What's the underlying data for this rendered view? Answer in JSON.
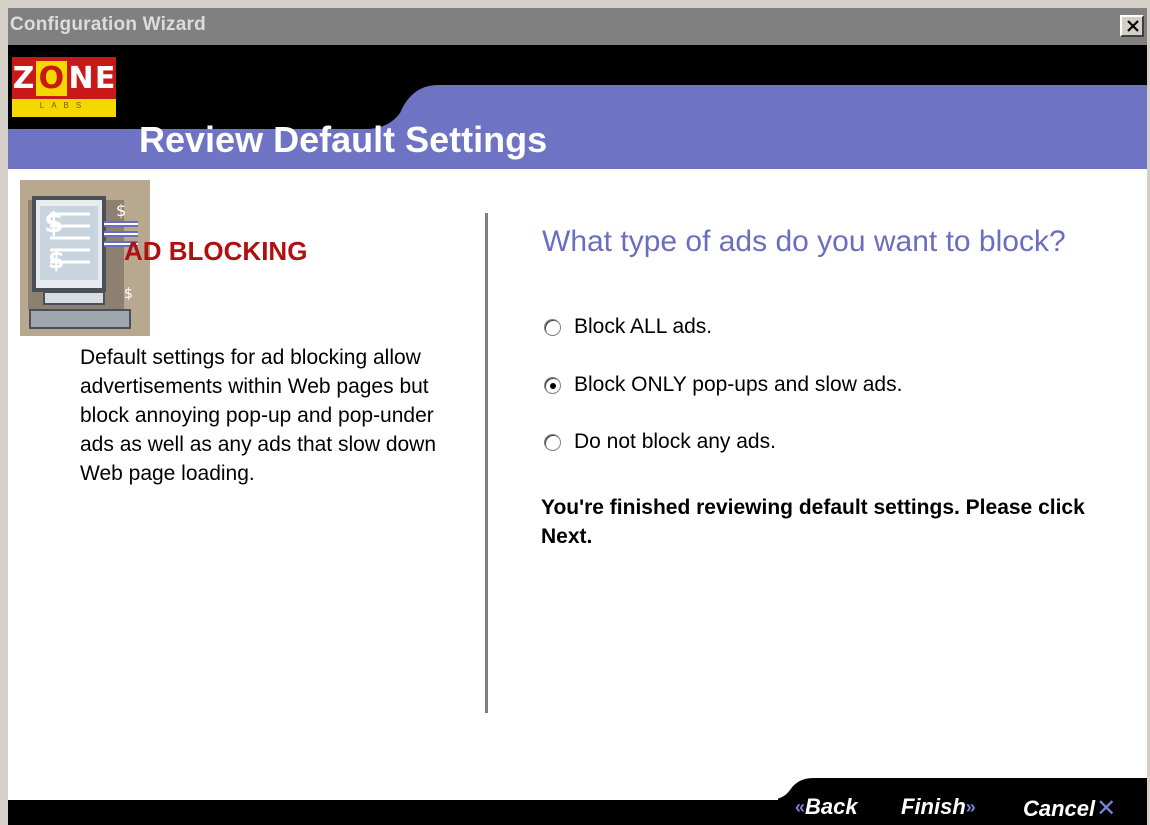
{
  "window": {
    "title": "Configuration Wizard"
  },
  "logo": {
    "letters": [
      "Z",
      "O",
      "N",
      "E"
    ],
    "sub": "LABS"
  },
  "header": {
    "title": "Review Default Settings"
  },
  "left": {
    "section_title": "AD BLOCKING",
    "description": "Default settings for ad blocking allow advertisements within Web pages but block annoying pop-up and pop-under ads as well as any ads that slow down Web page loading."
  },
  "right": {
    "question": "What type of ads do you want to block?",
    "options": [
      {
        "label": "Block ALL ads.",
        "checked": false
      },
      {
        "label": "Block ONLY pop-ups and slow ads.",
        "checked": true
      },
      {
        "label": "Do not block any ads.",
        "checked": false
      }
    ],
    "finish_note": "You're finished reviewing default settings. Please click Next."
  },
  "footer": {
    "back_label": "Back",
    "finish_label": "Finish",
    "cancel_label": "Cancel"
  },
  "colors": {
    "band": "#6f73c4",
    "accent": "#7a82d8",
    "section_title": "#b01010",
    "question": "#6a6ec0"
  },
  "icons": {
    "close": "close-icon",
    "back": "double-chevron-left-icon",
    "finish": "double-chevron-right-icon",
    "cancel": "x-icon",
    "hero": "computer-monitor-dollar-icon"
  }
}
